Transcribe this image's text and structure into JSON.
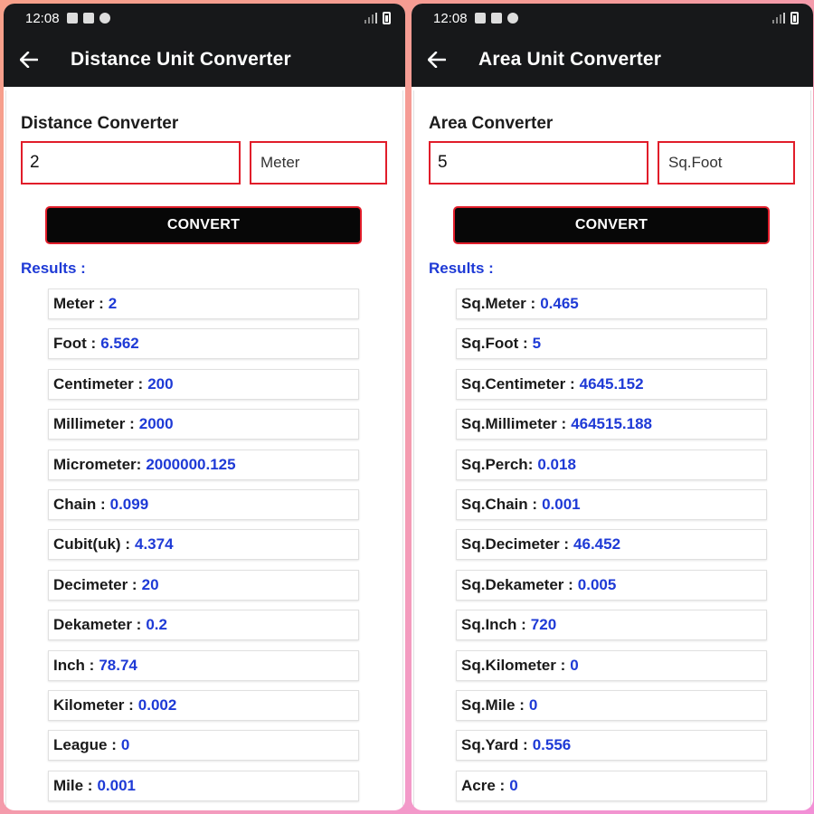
{
  "screens": [
    {
      "status_time": "12:08",
      "app_title": "Distance Unit Converter",
      "converter_title": "Distance Converter",
      "input_value": "2",
      "unit_selected": "Meter",
      "convert_label": "CONVERT",
      "results_label": "Results :",
      "results": [
        {
          "label": "Meter :",
          "value": "2"
        },
        {
          "label": "Foot :",
          "value": "6.562"
        },
        {
          "label": "Centimeter :",
          "value": "200"
        },
        {
          "label": "Millimeter :",
          "value": "2000"
        },
        {
          "label": "Micrometer:",
          "value": "2000000.125"
        },
        {
          "label": "Chain :",
          "value": "0.099"
        },
        {
          "label": "Cubit(uk) :",
          "value": "4.374"
        },
        {
          "label": "Decimeter :",
          "value": "20"
        },
        {
          "label": "Dekameter :",
          "value": "0.2"
        },
        {
          "label": "Inch :",
          "value": "78.74"
        },
        {
          "label": "Kilometer :",
          "value": "0.002"
        },
        {
          "label": "League :",
          "value": "0"
        },
        {
          "label": "Mile :",
          "value": "0.001"
        }
      ]
    },
    {
      "status_time": "12:08",
      "app_title": "Area Unit Converter",
      "converter_title": "Area Converter",
      "input_value": "5",
      "unit_selected": "Sq.Foot",
      "convert_label": "CONVERT",
      "results_label": "Results :",
      "results": [
        {
          "label": "Sq.Meter :",
          "value": "0.465"
        },
        {
          "label": "Sq.Foot :",
          "value": "5"
        },
        {
          "label": "Sq.Centimeter :",
          "value": "4645.152"
        },
        {
          "label": "Sq.Millimeter :",
          "value": "464515.188"
        },
        {
          "label": "Sq.Perch:",
          "value": "0.018"
        },
        {
          "label": "Sq.Chain :",
          "value": "0.001"
        },
        {
          "label": "Sq.Decimeter :",
          "value": "46.452"
        },
        {
          "label": "Sq.Dekameter :",
          "value": "0.005"
        },
        {
          "label": "Sq.Inch :",
          "value": "720"
        },
        {
          "label": "Sq.Kilometer :",
          "value": "0"
        },
        {
          "label": "Sq.Mile :",
          "value": "0"
        },
        {
          "label": "Sq.Yard :",
          "value": "0.556"
        },
        {
          "label": "Acre :",
          "value": "0"
        }
      ]
    }
  ],
  "colors": {
    "accent_red": "#e11d2a",
    "result_blue": "#1e3ad6",
    "appbar_dark": "#17181a"
  },
  "icons": {
    "back": "arrow-back-icon",
    "status": [
      "image-icon",
      "qr-icon",
      "circle-icon",
      "signal-icon",
      "battery-icon"
    ]
  }
}
